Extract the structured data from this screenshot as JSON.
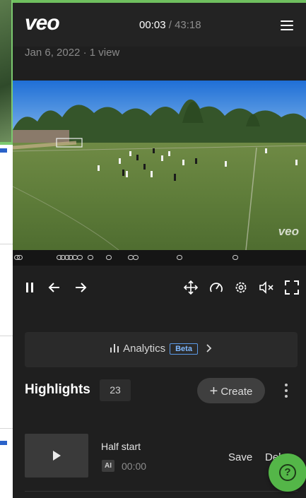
{
  "player": {
    "logo": "veo",
    "time_current": "00:03",
    "time_separator": " / ",
    "time_total": "43:18",
    "date": "Jan 6, 2022",
    "meta_separator": " · ",
    "views": "1 view",
    "watermark": "veo",
    "accent_color": "#6fbf5f"
  },
  "controls": {
    "icons": [
      "pause-icon",
      "rewind-icon",
      "forward-icon",
      "move-icon",
      "speed-icon",
      "settings-icon",
      "mute-icon",
      "fullscreen-icon"
    ]
  },
  "analytics": {
    "label": "Analytics",
    "badge": "Beta"
  },
  "highlights": {
    "title": "Highlights",
    "count": "23",
    "create_label": "Create",
    "items": [
      {
        "title": "Half start",
        "tag": "AI",
        "time": "00:00",
        "save_label": "Save",
        "delete_label": "Delete"
      }
    ]
  },
  "help": {
    "icon": "?",
    "color": "#54b648"
  }
}
